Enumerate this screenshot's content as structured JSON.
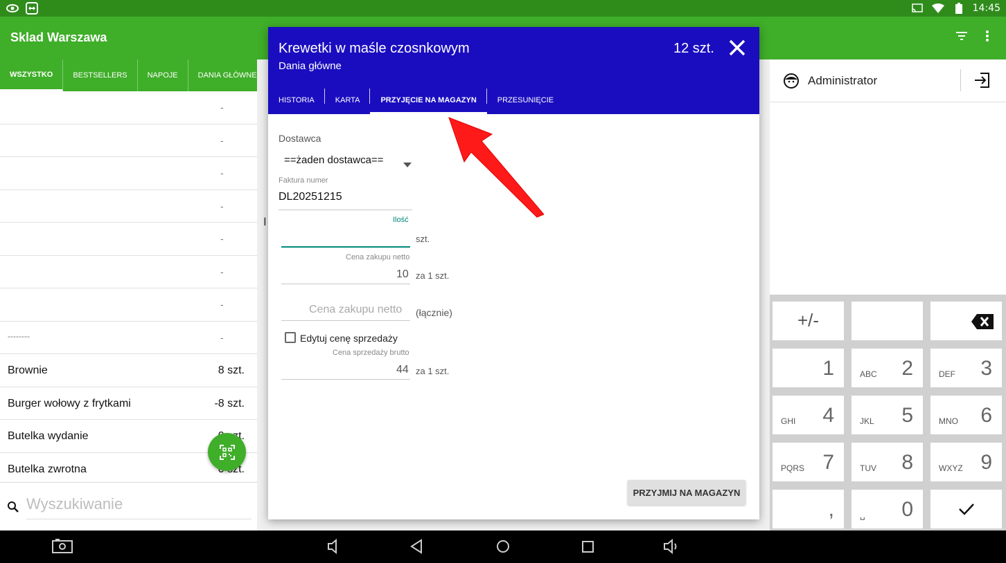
{
  "status_bar": {
    "time": "14:45",
    "left_icons": [
      "eye-icon",
      "teamviewer-icon"
    ],
    "right_icons": [
      "cast-icon",
      "wifi-icon",
      "battery-icon"
    ]
  },
  "app_bar": {
    "title": "Sklad Warszawa",
    "actions": [
      "filter-icon",
      "more-vert-icon"
    ]
  },
  "left_tabs": [
    {
      "label": "WSZYSTKO",
      "active": true
    },
    {
      "label": "BESTSELLERS",
      "active": false
    },
    {
      "label": "NAPOJE",
      "active": false
    },
    {
      "label": "DANIA GŁÓWNE",
      "active": false
    }
  ],
  "product_list": {
    "empty_rows": [
      "-",
      "-",
      "-",
      "-",
      "-",
      "-",
      "-"
    ],
    "dash_row": {
      "name": "--------",
      "qty": "-"
    },
    "items": [
      {
        "name": "Brownie",
        "qty": "8 szt."
      },
      {
        "name": "Burger wołowy z frytkami",
        "qty": "-8 szt."
      },
      {
        "name": "Butelka wydanie",
        "qty": "0 szt."
      },
      {
        "name": "Butelka zwrotna",
        "qty": "0 szt."
      }
    ]
  },
  "search": {
    "placeholder": "Wyszukiwanie"
  },
  "mid_letter": "I",
  "dialog": {
    "title": "Krewetki w maśle czosnkowym",
    "subtitle": "Dania główne",
    "count": "12 szt.",
    "tabs": [
      {
        "label": "HISTORIA",
        "active": false
      },
      {
        "label": "KARTA",
        "active": false
      },
      {
        "label": "PRZYJĘCIE NA MAGAZYN",
        "active": true
      },
      {
        "label": "PRZESUNIĘCIE",
        "active": false
      }
    ],
    "form": {
      "supplier_label": "Dostawca",
      "supplier_value": "==żaden dostawca==",
      "invoice_label": "Faktura numer",
      "invoice_value": "DL20251215",
      "quantity_label": "Ilość",
      "quantity_unit": "szt.",
      "net_price_label": "Cena zakupu netto",
      "net_price_value": "10",
      "net_price_unit": "za 1 szt.",
      "net_total_placeholder": "Cena zakupu netto",
      "net_total_unit": "(łącznie)",
      "edit_price_label": "Edytuj cenę sprzedaży",
      "gross_price_label": "Cena sprzedaży brutto",
      "gross_price_value": "44",
      "gross_price_unit": "za 1 szt.",
      "submit_label": "PRZYJMIJ NA MAGAZYN"
    }
  },
  "user_panel": {
    "name": "Administrator"
  },
  "keypad": {
    "keys": [
      {
        "main": "+/-",
        "letters": ""
      },
      {
        "main": "",
        "letters": ""
      },
      {
        "main": "⌫",
        "letters": ""
      },
      {
        "main": "1",
        "letters": ""
      },
      {
        "main": "2",
        "letters": "ABC"
      },
      {
        "main": "3",
        "letters": "DEF"
      },
      {
        "main": "4",
        "letters": "GHI"
      },
      {
        "main": "5",
        "letters": "JKL"
      },
      {
        "main": "6",
        "letters": "MNO"
      },
      {
        "main": "7",
        "letters": "PQRS"
      },
      {
        "main": "8",
        "letters": "TUV"
      },
      {
        "main": "9",
        "letters": "WXYZ"
      },
      {
        "main": ",",
        "letters": ""
      },
      {
        "main": "0",
        "letters": "␣"
      },
      {
        "main": "✓",
        "letters": ""
      }
    ]
  },
  "colors": {
    "status_green": "#2f8c1b",
    "app_green": "#3fae29",
    "dialog_blue": "#1a0dbf",
    "accent_teal": "#00897b",
    "arrow_red": "#ff1a1a"
  }
}
